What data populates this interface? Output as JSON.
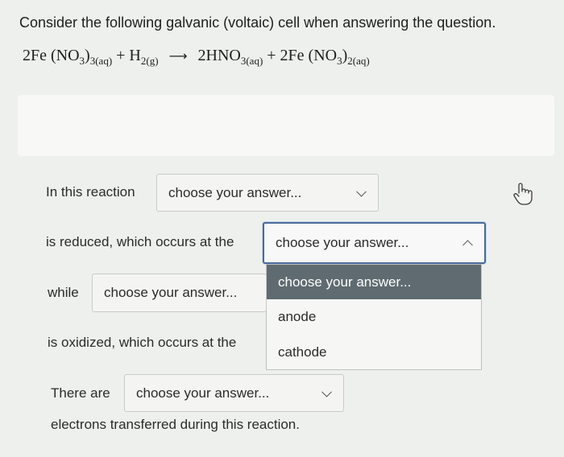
{
  "question": {
    "text": "Consider the following galvanic (voltaic) cell when answering the question."
  },
  "equation": {
    "reactant1": "2Fe (NO",
    "reactant1_sub1": "3",
    "reactant1_close": ")",
    "reactant1_sub2": "3(aq)",
    "plus1": "+ H",
    "reactant2_sub": "2(g)",
    "arrow": "⟶",
    "product1": "2HNO",
    "product1_sub": "3(aq)",
    "plus2": "+ 2Fe (NO",
    "product2_sub1": "3",
    "product2_close": ")",
    "product2_sub2": "2(aq)"
  },
  "statements": {
    "in_this_reaction": "In this reaction",
    "is_reduced": "is reduced, which occurs at the",
    "while": "while",
    "is_oxidized": "is oxidized, which occurs at the",
    "there_are": "There are",
    "electrons": "electrons transferred during this reaction."
  },
  "selects": {
    "reduced_species": "choose your answer...",
    "reduction_site": "choose your answer...",
    "oxidized_species": "choose your answer...",
    "electron_count": "choose your answer..."
  },
  "dropdown": {
    "options": [
      "choose your answer...",
      "anode",
      "cathode"
    ]
  },
  "icons": {
    "cursor": "hand-pointer-icon"
  }
}
